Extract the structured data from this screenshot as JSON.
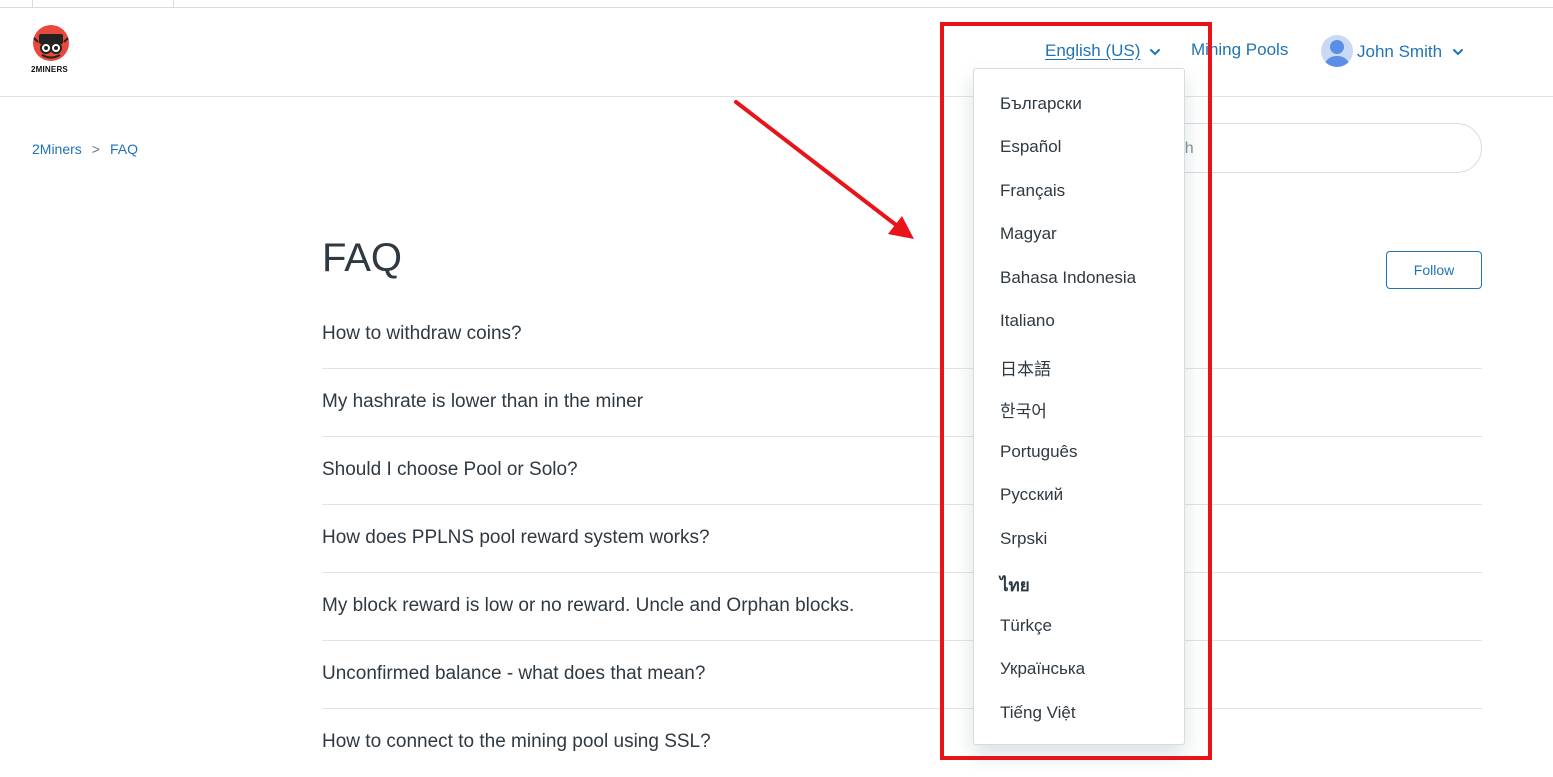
{
  "header": {
    "logo_text": "2MINERS",
    "language_current": "English (US)",
    "nav_mining_pools": "Mining Pools",
    "user_name": "John Smith"
  },
  "breadcrumb": {
    "items": [
      "2Miners",
      "FAQ"
    ],
    "separator": ">"
  },
  "search": {
    "placeholder": "Search"
  },
  "main": {
    "title": "FAQ",
    "follow_label": "Follow",
    "articles": [
      "How to withdraw coins?",
      "My hashrate is lower than in the miner",
      "Should I choose Pool or Solo?",
      "How does PPLNS pool reward system works?",
      "My block reward is low or no reward. Uncle and Orphan blocks.",
      "Unconfirmed balance - what does that mean?",
      "How to connect to the mining pool using SSL?"
    ]
  },
  "language_menu": {
    "options": [
      "Български",
      "Español",
      "Français",
      "Magyar",
      "Bahasa Indonesia",
      "Italiano",
      "日本語",
      "한국어",
      "Português",
      "Русский",
      "Srpski",
      "ไทย",
      "Türkçe",
      "Українська",
      "Tiếng Việt"
    ]
  },
  "colors": {
    "link": "#1f73b7",
    "text": "#2f3941",
    "annotation_red": "#e8141a",
    "logo_red": "#e9483a"
  },
  "icons": {
    "language_chevron": "chevron-down-icon",
    "user_chevron": "chevron-down-icon",
    "avatar": "user-avatar-icon",
    "logo": "2miners-logo"
  }
}
